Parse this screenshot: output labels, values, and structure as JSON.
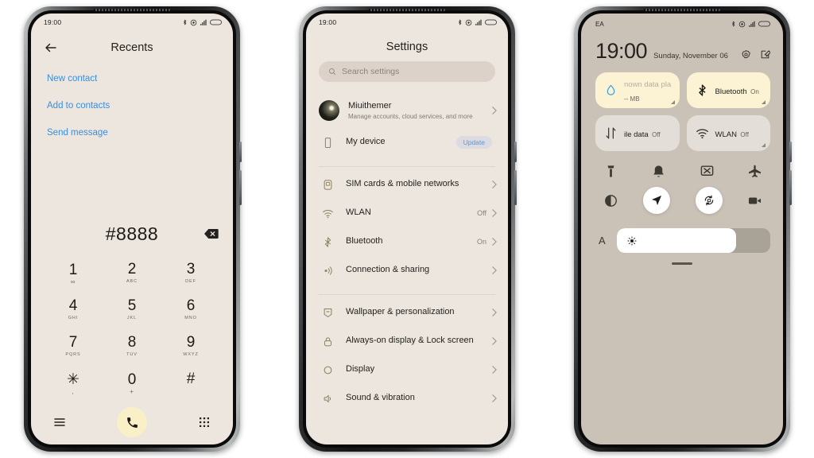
{
  "phones": {
    "dialer": {
      "statusbar": {
        "time": "19:00",
        "icons": [
          "bluetooth-icon",
          "vibrate-icon",
          "signal-icon",
          "battery-icon"
        ]
      },
      "header": {
        "back": "back-arrow-icon",
        "title": "Recents"
      },
      "links": [
        "New contact",
        "Add to contacts",
        "Send message"
      ],
      "number": "#8888",
      "backspace": "backspace-icon",
      "keys": [
        {
          "main": "1",
          "sub": "∞"
        },
        {
          "main": "2",
          "sub": "ABC"
        },
        {
          "main": "3",
          "sub": "DEF"
        },
        {
          "main": "4",
          "sub": "GHI"
        },
        {
          "main": "5",
          "sub": "JKL"
        },
        {
          "main": "6",
          "sub": "MNO"
        },
        {
          "main": "7",
          "sub": "PQRS"
        },
        {
          "main": "8",
          "sub": "TUV"
        },
        {
          "main": "9",
          "sub": "WXYZ"
        },
        {
          "main": "✳",
          "sub": ","
        },
        {
          "main": "0",
          "sub": "+"
        },
        {
          "main": "#",
          "sub": ""
        }
      ],
      "bottom": {
        "menu": "menu-icon",
        "call": "call-icon",
        "keypad": "keypad-icon"
      }
    },
    "settings": {
      "statusbar": {
        "time": "19:00"
      },
      "title": "Settings",
      "search": {
        "placeholder": "Search settings",
        "icon": "search-icon"
      },
      "account": {
        "name": "Miuithemer",
        "subtitle": "Manage accounts, cloud services, and more"
      },
      "device": {
        "label": "My device",
        "badge": "Update",
        "icon": "phone-icon"
      },
      "group1": [
        {
          "label": "SIM cards & mobile networks",
          "value": "",
          "icon": "sim-icon"
        },
        {
          "label": "WLAN",
          "value": "Off",
          "icon": "wifi-icon"
        },
        {
          "label": "Bluetooth",
          "value": "On",
          "icon": "bluetooth-icon"
        },
        {
          "label": "Connection & sharing",
          "value": "",
          "icon": "share-icon"
        }
      ],
      "group2": [
        {
          "label": "Wallpaper & personalization",
          "value": "",
          "icon": "wallpaper-icon"
        },
        {
          "label": "Always-on display & Lock screen",
          "value": "",
          "icon": "lock-icon"
        },
        {
          "label": "Display",
          "value": "",
          "icon": "display-icon"
        },
        {
          "label": "Sound & vibration",
          "value": "",
          "icon": "sound-icon"
        }
      ]
    },
    "control_center": {
      "statusbar": {
        "carrier": "EA"
      },
      "time": "19:00",
      "date": "Sunday, November 06",
      "head_icons": [
        "settings-gear-icon",
        "edit-icon"
      ],
      "tiles": [
        {
          "name": "nown data pla",
          "sub": "-- MB",
          "state": "on",
          "icon": "data-usage-icon",
          "truncated": true
        },
        {
          "name": "Bluetooth",
          "sub": "On",
          "state": "on",
          "icon": "bluetooth-icon",
          "truncated": false
        },
        {
          "name": "ile data",
          "sub": "Off",
          "state": "off",
          "icon": "mobile-data-icon",
          "truncated": true
        },
        {
          "name": "WLAN",
          "sub": "Off",
          "state": "off",
          "icon": "wifi-icon",
          "truncated": false
        }
      ],
      "icon_row_1": [
        "flashlight-icon",
        "bell-icon",
        "cast-icon",
        "airplane-icon"
      ],
      "icon_row_2": [
        "dark-mode-icon",
        "location-icon",
        "auto-rotate-icon",
        "screen-record-icon"
      ],
      "brightness": {
        "auto_label": "A",
        "icon": "sun-icon",
        "percent": 78
      }
    }
  },
  "colors": {
    "screen_cream": "#ece6de",
    "screen_taupe": "#cac2b7",
    "tile_on": "#fbf3d3",
    "tile_off": "#e3ded7",
    "link_blue": "#3b8ede",
    "badge_blue": "#5f95d8"
  }
}
